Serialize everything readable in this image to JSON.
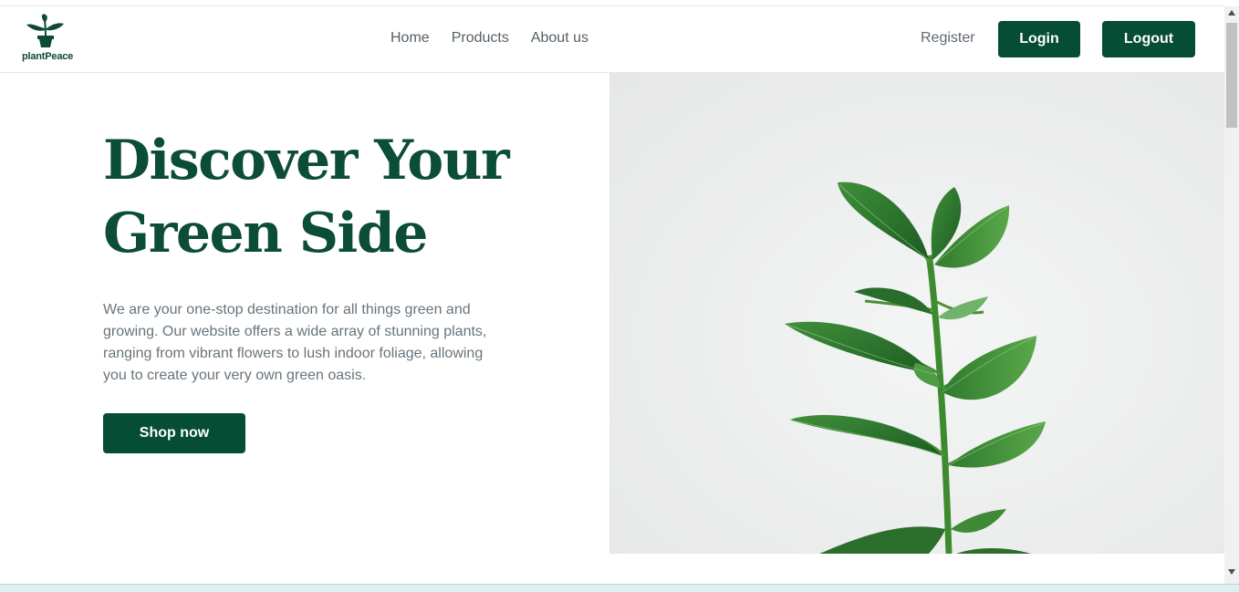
{
  "brand": {
    "name": "plantPeace",
    "logo_icon": "plant-pot-icon",
    "color": "#064d36"
  },
  "nav": {
    "items": [
      {
        "label": "Home"
      },
      {
        "label": "Products"
      },
      {
        "label": "About us"
      }
    ],
    "register_label": "Register",
    "login_label": "Login",
    "logout_label": "Logout"
  },
  "hero": {
    "title": "Discover Your Green Side",
    "description": "We are your one-stop destination for all things green and growing. Our website offers a wide array of stunning plants, ranging from vibrant flowers to lush indoor foliage, allowing you to create your very own green oasis.",
    "cta_label": "Shop now",
    "image_subject": "rubber-plant-photo"
  }
}
